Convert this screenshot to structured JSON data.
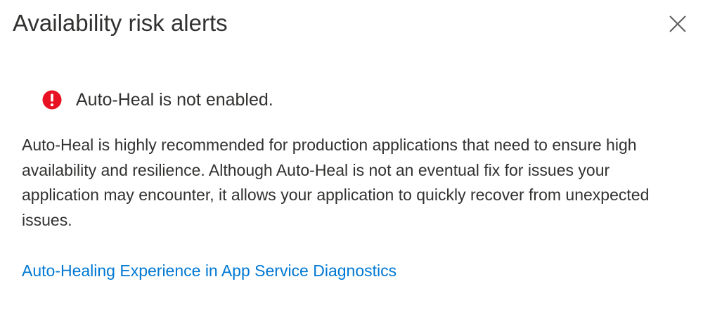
{
  "dialog": {
    "title": "Availability risk alerts",
    "close_icon": "close-icon"
  },
  "alert": {
    "icon": "error-icon",
    "icon_color": "#e81123",
    "message": "Auto-Heal is not enabled."
  },
  "description": "Auto-Heal is highly recommended for production applications that need to ensure high availability and resilience. Although Auto-Heal is not an eventual fix for issues your application may encounter, it allows your application to quickly recover from unexpected issues.",
  "link": {
    "label": "Auto-Healing Experience in App Service Diagnostics",
    "color": "#0078d4"
  }
}
